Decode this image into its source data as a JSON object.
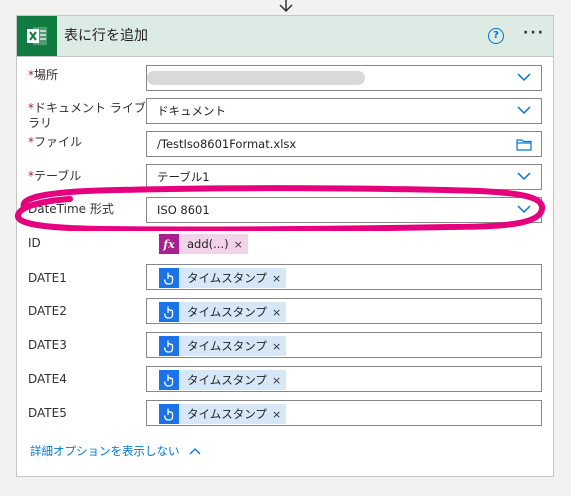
{
  "card": {
    "title": "表に行を追加",
    "app_icon": "excel-icon",
    "help_icon": "question-icon",
    "more_icon": "more-icon"
  },
  "fields": {
    "location": {
      "label": "場所",
      "required": true,
      "value": ""
    },
    "doc_library": {
      "label": "ドキュメント ライブラリ",
      "required": true,
      "value": "ドキュメント"
    },
    "file": {
      "label": "ファイル",
      "required": true,
      "value": "/TestIso8601Format.xlsx"
    },
    "table": {
      "label": "テーブル",
      "required": true,
      "value": "テーブル1"
    },
    "datetime_format": {
      "label": "DateTime 形式",
      "required": false,
      "value": "ISO 8601"
    },
    "id": {
      "label": "ID",
      "token_icon": "fx",
      "token_label": "add(...)"
    },
    "date1": {
      "label": "DATE1",
      "token_label": "タイムスタンプ"
    },
    "date2": {
      "label": "DATE2",
      "token_label": "タイムスタンプ"
    },
    "date3": {
      "label": "DATE3",
      "token_label": "タイムスタンプ"
    },
    "date4": {
      "label": "DATE4",
      "token_label": "タイムスタンプ"
    },
    "date5": {
      "label": "DATE5",
      "token_label": "タイムスタンプ"
    }
  },
  "required_mark": "*",
  "remove_mark": "×",
  "advanced_options": {
    "label": "詳細オプションを表示しない"
  },
  "colors": {
    "excel_green": "#107c41",
    "header_bg": "#dcebe3",
    "accent_blue": "#0078d4",
    "highlight_magenta": "#e6007e",
    "expression_token": "#aa1f8f",
    "timestamp_token": "#1a73e8"
  }
}
